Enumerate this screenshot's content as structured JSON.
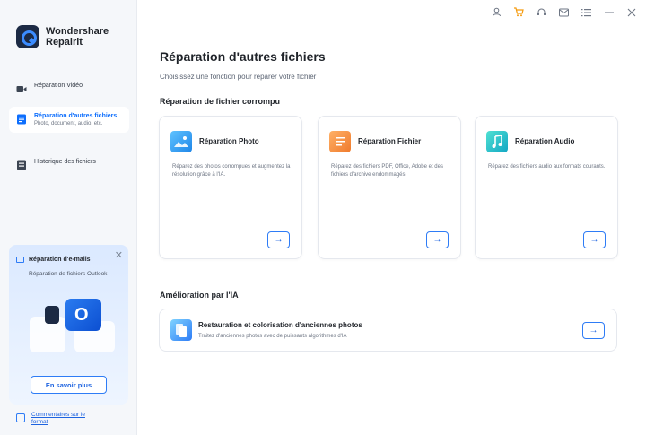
{
  "brand": {
    "line1": "Wondershare",
    "line2": "Repairit"
  },
  "sidebar": {
    "items": [
      {
        "label": "Réparation Vidéo",
        "sub": ""
      },
      {
        "label": "Réparation d'autres fichiers",
        "sub": "Photo, document, audio, etc."
      },
      {
        "label": "Historique des fichiers",
        "sub": ""
      }
    ],
    "promo": {
      "title": "Réparation d'e-mails",
      "desc": "Réparation de fichiers Outlook",
      "button": "En savoir plus",
      "close": "✕",
      "art_letter": "O"
    },
    "feedback": "Commentaires sur le format"
  },
  "titlebar": {
    "icons": [
      "user-icon",
      "cart-icon",
      "headset-icon",
      "mail-icon",
      "menu-icon",
      "minimize-icon",
      "close-icon"
    ],
    "accent": "#f59a0c"
  },
  "main": {
    "title": "Réparation d'autres fichiers",
    "subtitle": "Choisissez une fonction pour réparer votre fichier",
    "section1": "Réparation de fichier corrompu",
    "cards": [
      {
        "title": "Réparation Photo",
        "desc": "Réparez des photos corrompues et augmentez la résolution grâce à l'IA.",
        "color": "#2e9cf0",
        "arrow": "→"
      },
      {
        "title": "Réparation Fichier",
        "desc": "Réparez des fichiers PDF, Office, Adobe et des fichiers d'archive endommagés.",
        "color": "#f08a3c",
        "arrow": "→"
      },
      {
        "title": "Réparation Audio",
        "desc": "Réparez des fichiers audio aux formats courants.",
        "color": "#19b8c9",
        "arrow": "→"
      }
    ],
    "section2": "Amélioration par l'IA",
    "ai_card": {
      "title": "Restauration et colorisation d'anciennes photos",
      "desc": "Traitez d'anciennes photos avec de puissants algorithmes d'IA",
      "arrow": "→"
    }
  },
  "colors": {
    "primary": "#2e7cf6",
    "text": "#1f2329"
  }
}
